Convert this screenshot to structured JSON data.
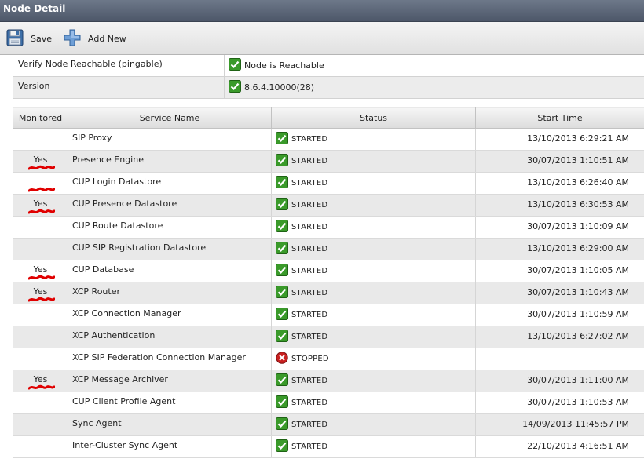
{
  "window": {
    "title": "Node Detail"
  },
  "toolbar": {
    "save_label": "Save",
    "add_new_label": "Add New"
  },
  "node_info": [
    {
      "label": "Verify Node Reachable (pingable)",
      "value": "Node is Reachable",
      "icon": "check-icon"
    },
    {
      "label": "Version",
      "value": "8.6.4.10000(28)",
      "icon": "check-icon"
    }
  ],
  "table": {
    "headers": {
      "monitored": "Monitored",
      "service_name": "Service Name",
      "status": "Status",
      "start_time": "Start Time"
    },
    "rows": [
      {
        "monitored": "",
        "service": "SIP Proxy",
        "status": "STARTED",
        "start_time": "13/10/2013 6:29:21 AM"
      },
      {
        "monitored": "Yes",
        "service": "Presence Engine",
        "status": "STARTED",
        "start_time": "30/07/2013 1:10:51 AM"
      },
      {
        "monitored": "",
        "service": "CUP Login Datastore",
        "status": "STARTED",
        "start_time": "13/10/2013 6:26:40 AM"
      },
      {
        "monitored": "Yes",
        "service": "CUP Presence Datastore",
        "status": "STARTED",
        "start_time": "13/10/2013 6:30:53 AM"
      },
      {
        "monitored": "",
        "service": "CUP Route Datastore",
        "status": "STARTED",
        "start_time": "30/07/2013 1:10:09 AM"
      },
      {
        "monitored": "",
        "service": "CUP SIP Registration Datastore",
        "status": "STARTED",
        "start_time": "13/10/2013 6:29:00 AM"
      },
      {
        "monitored": "Yes",
        "service": "CUP Database",
        "status": "STARTED",
        "start_time": "30/07/2013 1:10:05 AM"
      },
      {
        "monitored": "Yes",
        "service": "XCP Router",
        "status": "STARTED",
        "start_time": "30/07/2013 1:10:43 AM"
      },
      {
        "monitored": "",
        "service": "XCP Connection Manager",
        "status": "STARTED",
        "start_time": "30/07/2013 1:10:59 AM"
      },
      {
        "monitored": "",
        "service": "XCP Authentication",
        "status": "STARTED",
        "start_time": "13/10/2013 6:27:02 AM"
      },
      {
        "monitored": "",
        "service": "XCP SIP Federation Connection Manager",
        "status": "STOPPED",
        "start_time": ""
      },
      {
        "monitored": "Yes",
        "service": "XCP Message Archiver",
        "status": "STARTED",
        "start_time": "30/07/2013 1:11:00 AM"
      },
      {
        "monitored": "",
        "service": "CUP Client Profile Agent",
        "status": "STARTED",
        "start_time": "30/07/2013 1:10:53 AM"
      },
      {
        "monitored": "",
        "service": "Sync Agent",
        "status": "STARTED",
        "start_time": "14/09/2013 11:45:57 PM"
      },
      {
        "monitored": "",
        "service": "Inter-Cluster Sync Agent",
        "status": "STARTED",
        "start_time": "22/10/2013 4:16:51 AM"
      }
    ]
  },
  "icons": {
    "save": "floppy-disk-icon",
    "add": "plus-icon",
    "started": "green-check-icon",
    "stopped": "red-x-icon"
  },
  "colors": {
    "title_bar": "#5d6779",
    "check_green": "#3a9a2a",
    "stopped_red": "#c82020",
    "annotation_red": "#e00000"
  }
}
